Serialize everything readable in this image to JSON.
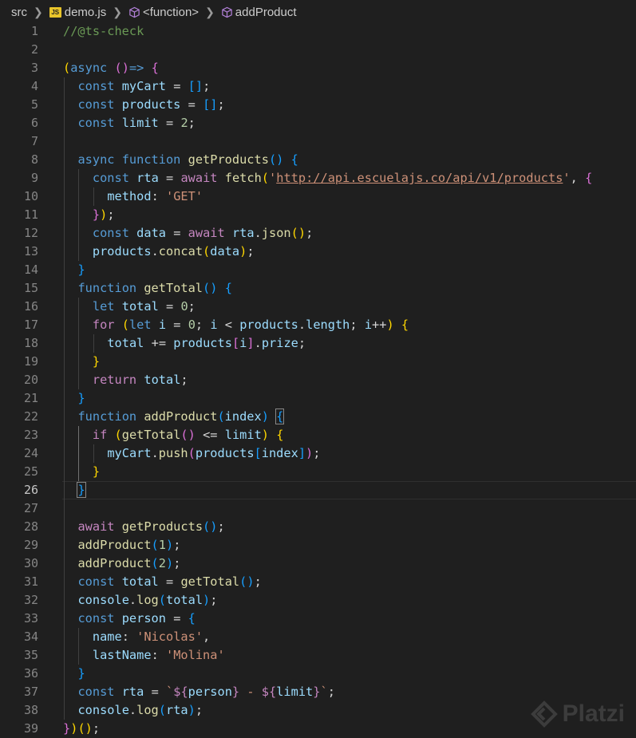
{
  "breadcrumb": {
    "folder": "src",
    "file": "demo.js",
    "file_badge": "JS",
    "scope1": "<function>",
    "scope2": "addProduct"
  },
  "editor": {
    "active_line": 26,
    "lines": [
      "//@ts-check",
      "",
      "(async ()=> {",
      "  const myCart = [];",
      "  const products = [];",
      "  const limit = 2;",
      "",
      "  async function getProducts() {",
      "    const rta = await fetch('http://api.escuelajs.co/api/v1/products', {",
      "      method: 'GET'",
      "    });",
      "    const data = await rta.json();",
      "    products.concat(data);",
      "  }",
      "  function getTotal() {",
      "    let total = 0;",
      "    for (let i = 0; i < products.length; i++) {",
      "      total += products[i].prize;",
      "    }",
      "    return total;",
      "  }",
      "  function addProduct(index) {",
      "    if (getTotal() <= limit) {",
      "      myCart.push(products[index]);",
      "    }",
      "  }",
      "",
      "  await getProducts();",
      "  addProduct(1);",
      "  addProduct(2);",
      "  const total = getTotal();",
      "  console.log(total);",
      "  const person = {",
      "    name: 'Nicolas',",
      "    lastName: 'Molina'",
      "  }",
      "  const rta = `${person} - ${limit}`;",
      "  console.log(rta);",
      "})();"
    ]
  },
  "watermark": {
    "text": "Platzi"
  },
  "colors": {
    "background": "#1f1f1f",
    "keyword": "#569cd6",
    "control": "#c586c0",
    "function": "#dcdcaa",
    "variable": "#9cdcfe",
    "number": "#b5cea8",
    "string": "#ce9178",
    "comment": "#6a9955"
  },
  "icons": [
    "chevron-right-icon",
    "js-file-icon",
    "cube-icon",
    "platzi-logo-icon"
  ]
}
